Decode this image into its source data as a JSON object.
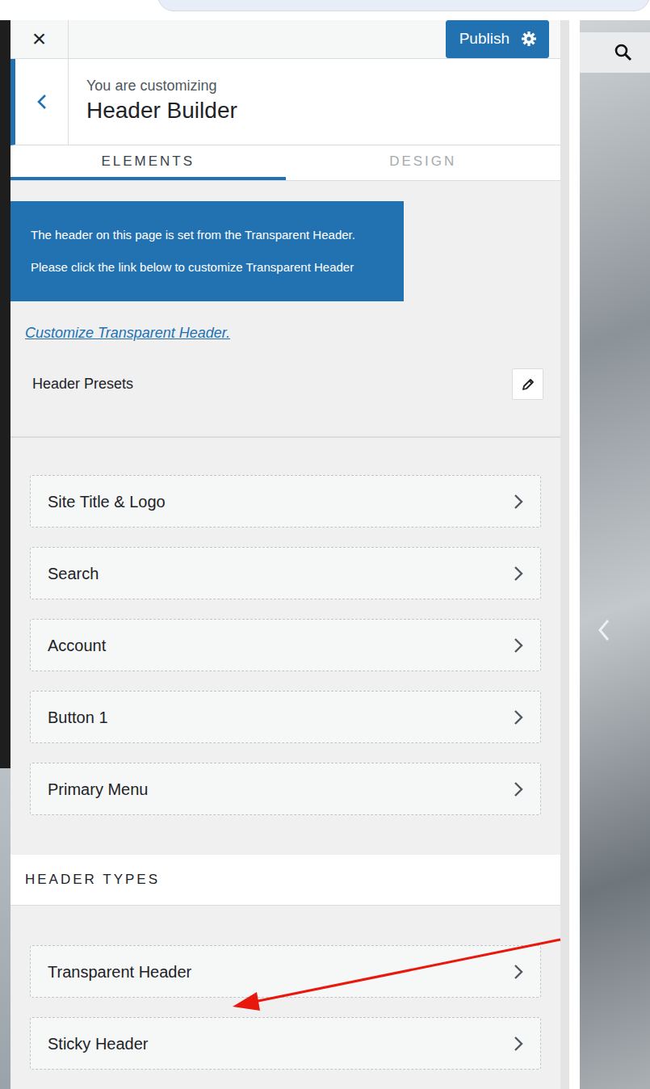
{
  "controls": {
    "close": "×",
    "publish": "Publish"
  },
  "section": {
    "context": "You are customizing",
    "title": "Header Builder"
  },
  "tabs": [
    {
      "label": "ELEMENTS",
      "selected": true
    },
    {
      "label": "DESIGN",
      "selected": false
    }
  ],
  "notice": {
    "lines": [
      "The header on this page is set from the Transparent Header.",
      "Please click the link below to customize Transparent Header"
    ]
  },
  "link": "Customize Transparent Header.",
  "presets": {
    "label": "Header Presets"
  },
  "elements": [
    "Site Title & Logo",
    "Search",
    "Account",
    "Button 1",
    "Primary Menu"
  ],
  "header_types": {
    "heading": "HEADER TYPES",
    "items": [
      "Transparent Header",
      "Sticky Header"
    ]
  }
}
